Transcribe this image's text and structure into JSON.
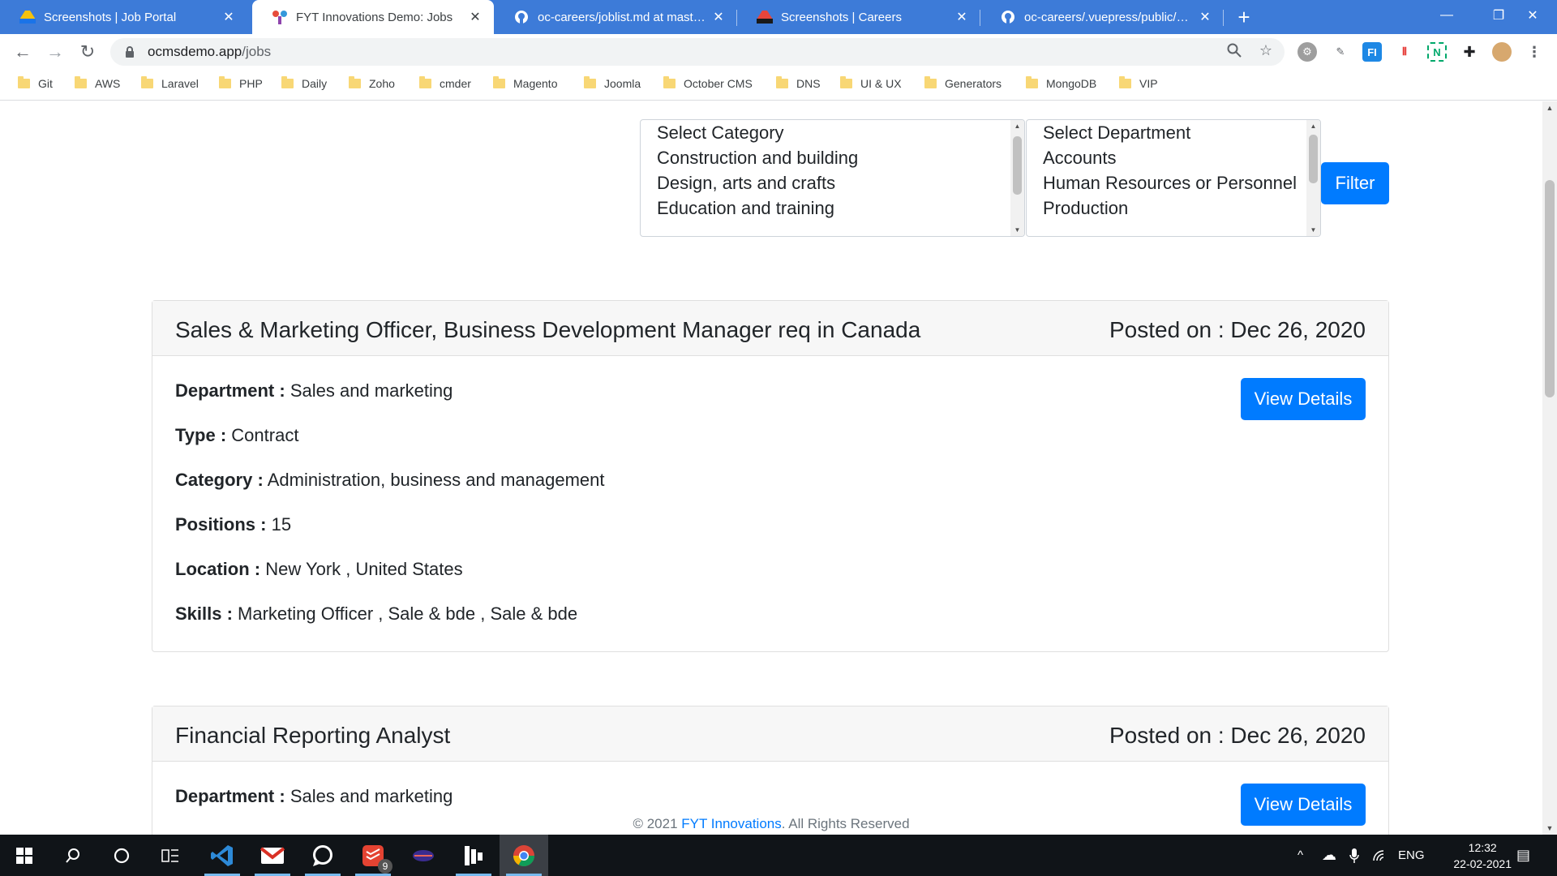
{
  "browser": {
    "tabs": [
      {
        "title": "Screenshots | Job Portal",
        "active": false,
        "favicon": "drive-icon"
      },
      {
        "title": "FYT Innovations Demo: Jobs",
        "active": true,
        "favicon": "fyt-logo-icon"
      },
      {
        "title": "oc-careers/joblist.md at master ·",
        "active": false,
        "favicon": "github-icon"
      },
      {
        "title": "Screenshots | Careers",
        "active": false,
        "favicon": "drive-icon"
      },
      {
        "title": "oc-careers/.vuepress/public/asse",
        "active": false,
        "favicon": "github-icon"
      }
    ],
    "url_host": "ocmsdemo.app",
    "url_path": "/jobs",
    "bookmarks": [
      "Git",
      "AWS",
      "Laravel",
      "PHP",
      "Daily",
      "Zoho",
      "cmder",
      "Magento",
      "Joomla",
      "October CMS",
      "DNS",
      "UI & UX",
      "Generators",
      "MongoDB",
      "VIP"
    ]
  },
  "filters": {
    "category_options": [
      "Select Category",
      "Construction and building",
      "Design, arts and crafts",
      "Education and training"
    ],
    "department_options": [
      "Select Department",
      "Accounts",
      "Human Resources or Personnel",
      "Production"
    ],
    "filter_button": "Filter"
  },
  "jobs": [
    {
      "title": "Sales & Marketing Officer, Business Development Manager req in Canada",
      "posted": "Posted on : Dec 26, 2020",
      "view_label": "View Details",
      "fields": [
        {
          "label": "Department :",
          "value": "Sales and marketing"
        },
        {
          "label": "Type :",
          "value": "Contract"
        },
        {
          "label": "Category :",
          "value": "Administration, business and management"
        },
        {
          "label": "Positions :",
          "value": "15"
        },
        {
          "label": "Location :",
          "value": "New York , United States"
        },
        {
          "label": "Skills :",
          "value": "Marketing Officer , Sale & bde , Sale & bde"
        }
      ]
    },
    {
      "title": "Financial Reporting Analyst",
      "posted": "Posted on : Dec 26, 2020",
      "view_label": "View Details",
      "fields": [
        {
          "label": "Department :",
          "value": "Sales and marketing"
        }
      ]
    }
  ],
  "footer": {
    "prefix": "© 2021 ",
    "brand": "FYT Innovations",
    "suffix": ". All Rights Reserved"
  },
  "taskbar": {
    "language": "ENG",
    "time": "12:32",
    "date": "22-02-2021",
    "todoist_badge": "9"
  },
  "colors": {
    "tabstrip": "#3d7bd8",
    "primary": "#007bff",
    "taskbar": "#101418"
  }
}
